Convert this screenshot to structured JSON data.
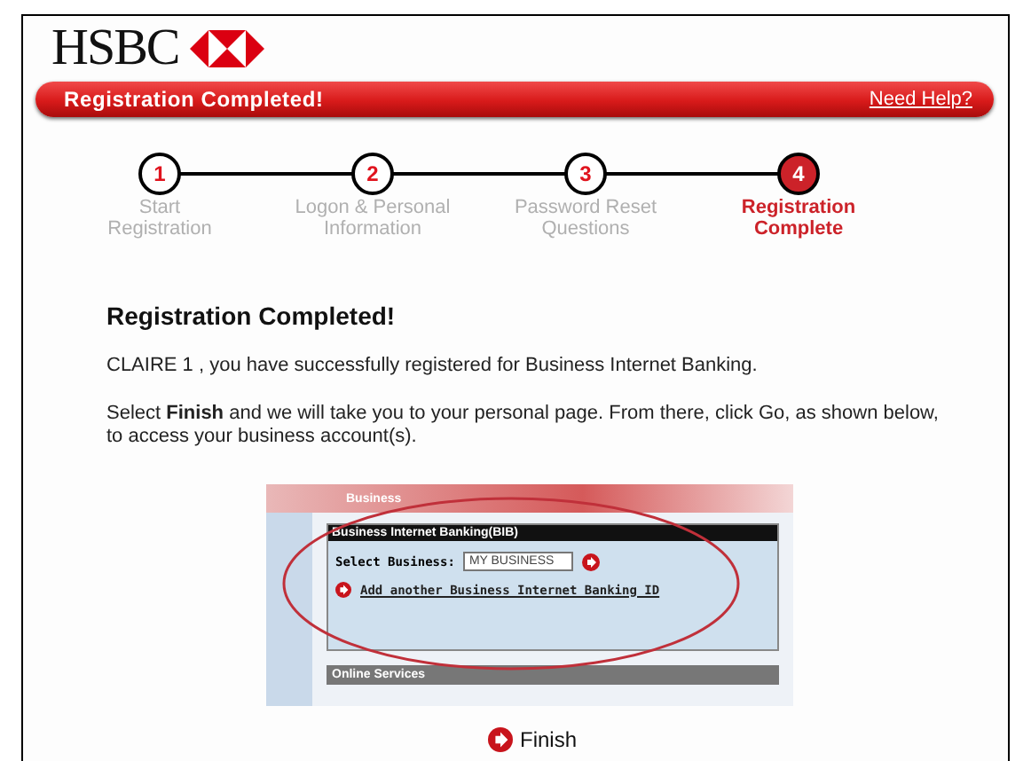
{
  "brand": {
    "name": "HSBC"
  },
  "banner": {
    "title": "Registration Completed!",
    "help_link": "Need Help?"
  },
  "steps": [
    {
      "number": "1",
      "label": "Start\nRegistration",
      "selected": false
    },
    {
      "number": "2",
      "label": "Logon & Personal\nInformation",
      "selected": false
    },
    {
      "number": "3",
      "label": "Password Reset\nQuestions",
      "selected": false
    },
    {
      "number": "4",
      "label": "Registration\nComplete",
      "selected": true
    }
  ],
  "heading": "Registration Completed!",
  "paragraphs": [
    "CLAIRE 1 , you have successfully registered for Business Internet Banking.",
    "Select **Finish** and we will take you to your personal page. From there, click Go, as shown below, to access your business account(s)."
  ],
  "example_screenshot": {
    "tab": "Business",
    "panel_title": "Business Internet Banking(BIB)",
    "select_label": "Select Business:",
    "select_value": "MY BUSINESS",
    "add_link": "Add another Business Internet Banking ID",
    "section_title": "Online Services"
  },
  "finish_button": "Finish"
}
